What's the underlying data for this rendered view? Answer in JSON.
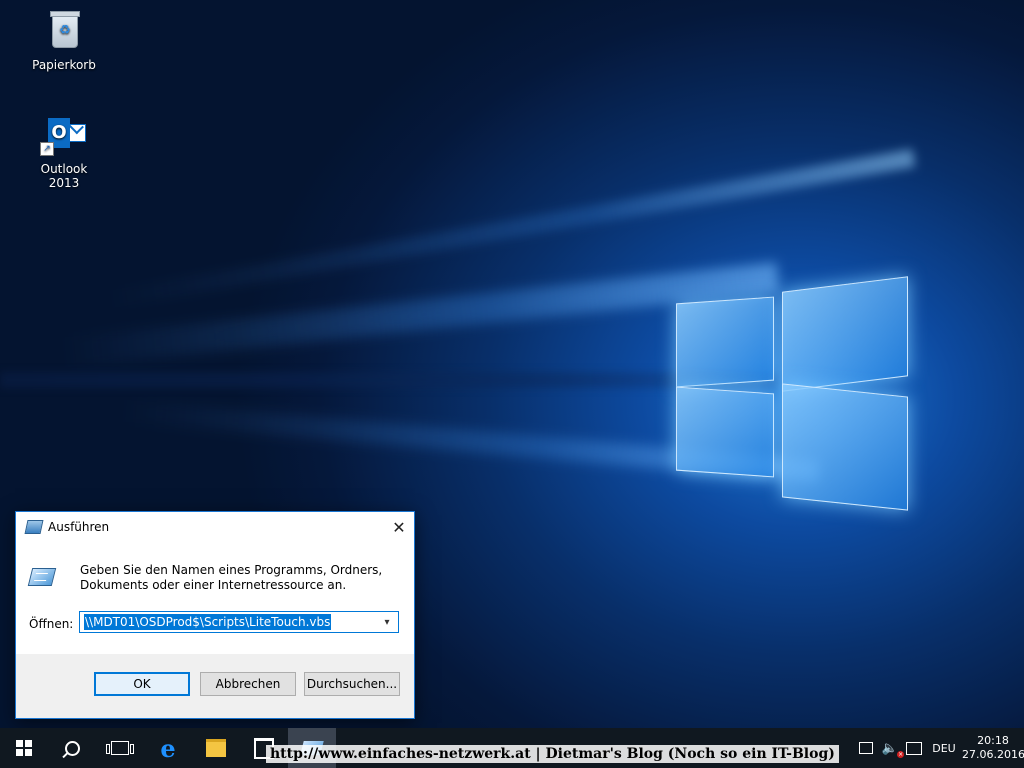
{
  "desktop": {
    "icons": [
      {
        "label": "Papierkorb",
        "icon": "recycle-bin-icon"
      },
      {
        "label": "Outlook 2013",
        "icon": "outlook-icon"
      }
    ]
  },
  "run_dialog": {
    "title": "Ausführen",
    "description": "Geben Sie den Namen eines Programms, Ordners, Dokuments oder einer Internetressource an.",
    "open_label": "Öffnen:",
    "open_value": "\\\\MDT01\\OSDProd$\\Scripts\\LiteTouch.vbs",
    "buttons": {
      "ok": "OK",
      "cancel": "Abbrechen",
      "browse": "Durchsuchen..."
    },
    "close_glyph": "✕"
  },
  "taskbar": {
    "watermark": "http://www.einfaches-netzwerk.at | Dietmar's Blog (Noch so ein IT-Blog)",
    "edge_glyph": "e",
    "tray": {
      "language": "DEU",
      "time": "20:18",
      "date": "27.06.2016"
    }
  },
  "colors": {
    "accent": "#0078d7",
    "taskbar": "#101820"
  }
}
